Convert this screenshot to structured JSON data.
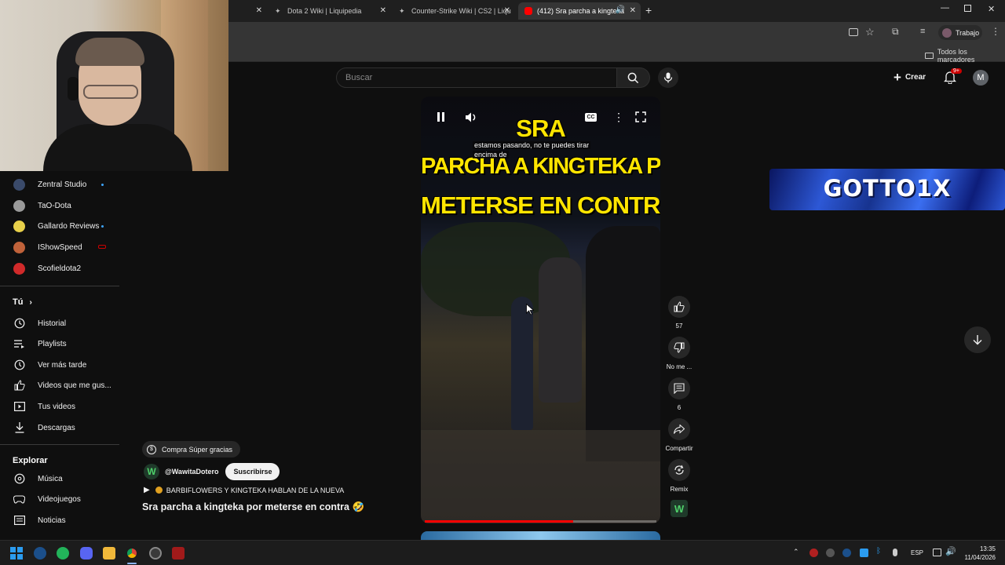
{
  "browser": {
    "tabs": [
      {
        "label": ""
      },
      {
        "label": "Dota 2 Wiki | Liquipedia"
      },
      {
        "label": "Counter-Strike Wiki | CS2 | Liqu"
      },
      {
        "label": "(412) Sra parcha a kingteka"
      }
    ],
    "profile_label": "Trabajo",
    "bookmarks_all": "Todos los marcadores"
  },
  "header": {
    "search_placeholder": "Buscar",
    "create_label": "Crear",
    "notifications_badge": "9+",
    "account_initial": "M"
  },
  "sidebar": {
    "subscriptions": [
      {
        "label": "Zentral Studio",
        "avatar_color": "#3a4a6a",
        "new": true
      },
      {
        "label": "TaO-Dota",
        "avatar_color": "#9a9a9a",
        "new": false
      },
      {
        "label": "Gallardo Reviews",
        "avatar_color": "#e8d04a",
        "new": true
      },
      {
        "label": "IShowSpeed",
        "avatar_color": "#c0623a",
        "new": false,
        "live": true
      },
      {
        "label": "Scofieldota2",
        "avatar_color": "#d02a2a",
        "new": false
      }
    ],
    "you_heading": "Tú",
    "you_items": [
      {
        "label": "Historial",
        "icon": "history-icon"
      },
      {
        "label": "Playlists",
        "icon": "playlist-icon"
      },
      {
        "label": "Ver más tarde",
        "icon": "watch-later-icon"
      },
      {
        "label": "Videos que me gus...",
        "icon": "thumbs-up-icon"
      },
      {
        "label": "Tus videos",
        "icon": "your-videos-icon"
      },
      {
        "label": "Descargas",
        "icon": "download-icon"
      }
    ],
    "explore_heading": "Explorar",
    "explore_items": [
      {
        "label": "Música",
        "icon": "music-icon"
      },
      {
        "label": "Videojuegos",
        "icon": "gaming-icon"
      },
      {
        "label": "Noticias",
        "icon": "news-icon"
      }
    ]
  },
  "short": {
    "overlay_line1": "SRA",
    "overlay_line2": "PARCHA A KINGTEKA POR",
    "overlay_line3": "METERSE EN CONTRA",
    "caption_line1": "estamos pasando, no te puedes tirar",
    "caption_line2": "encima de",
    "cc_label": "CC",
    "progress": 0.64,
    "super_thanks": "Compra Súper gracias",
    "channel": "@WawitaDotero",
    "subscribe": "Suscribirse",
    "playlist_line": "BARBIFLOWERS Y KINGTEKA HABLAN DE LA NUEVA",
    "title": "Sra parcha a kingteka por meterse en contra 🤣"
  },
  "actions": {
    "likes": "57",
    "dislike_label": "No me ...",
    "comments": "6",
    "share": "Compartir",
    "remix": "Remix"
  },
  "banner_text": "GOTTO1X",
  "taskbar": {
    "lang": "ESP",
    "time": "13:35",
    "date": "11/04/2026"
  },
  "colors": {
    "accent_red": "#ff0000",
    "link_blue": "#3ea6ff",
    "overlay_yellow": "#ffe500"
  }
}
